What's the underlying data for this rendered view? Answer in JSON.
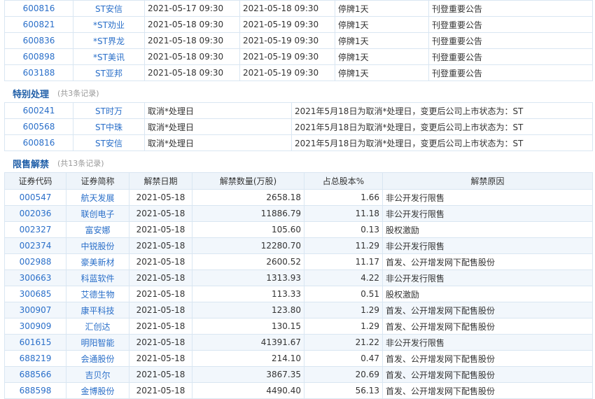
{
  "suspension": {
    "rows": [
      {
        "code": "600816",
        "name": "ST安信",
        "start": "2021-05-17 09:30",
        "end": "2021-05-18 09:30",
        "duration": "停牌1天",
        "reason": "刊登重要公告"
      },
      {
        "code": "600821",
        "name": "*ST劝业",
        "start": "2021-05-18 09:30",
        "end": "2021-05-19 09:30",
        "duration": "停牌1天",
        "reason": "刊登重要公告"
      },
      {
        "code": "600836",
        "name": "*ST界龙",
        "start": "2021-05-18 09:30",
        "end": "2021-05-19 09:30",
        "duration": "停牌1天",
        "reason": "刊登重要公告"
      },
      {
        "code": "600898",
        "name": "*ST美讯",
        "start": "2021-05-18 09:30",
        "end": "2021-05-19 09:30",
        "duration": "停牌1天",
        "reason": "刊登重要公告"
      },
      {
        "code": "603188",
        "name": "ST亚邦",
        "start": "2021-05-18 09:30",
        "end": "2021-05-19 09:30",
        "duration": "停牌1天",
        "reason": "刊登重要公告"
      }
    ]
  },
  "special": {
    "title": "特别处理",
    "count": "(共3条记录)",
    "rows": [
      {
        "code": "600241",
        "name": "ST时万",
        "type": "取消*处理日",
        "desc": "2021年5月18日为取消*处理日，变更后公司上市状态为：ST"
      },
      {
        "code": "600568",
        "name": "ST中珠",
        "type": "取消*处理日",
        "desc": "2021年5月18日为取消*处理日，变更后公司上市状态为：ST"
      },
      {
        "code": "600816",
        "name": "ST安信",
        "type": "取消*处理日",
        "desc": "2021年5月18日为取消*处理日，变更后公司上市状态为：ST"
      }
    ]
  },
  "unlock": {
    "title": "限售解禁",
    "count": "(共13条记录)",
    "headers": {
      "code": "证券代码",
      "name": "证券简称",
      "date": "解禁日期",
      "qty": "解禁数量(万股)",
      "pct": "占总股本%",
      "reason": "解禁原因"
    },
    "rows": [
      {
        "code": "000547",
        "name": "航天发展",
        "date": "2021-05-18",
        "qty": "2658.18",
        "pct": "1.66",
        "reason": "非公开发行限售"
      },
      {
        "code": "002036",
        "name": "联创电子",
        "date": "2021-05-18",
        "qty": "11886.79",
        "pct": "11.18",
        "reason": "非公开发行限售"
      },
      {
        "code": "002327",
        "name": "富安娜",
        "date": "2021-05-18",
        "qty": "105.60",
        "pct": "0.13",
        "reason": "股权激励"
      },
      {
        "code": "002374",
        "name": "中锐股份",
        "date": "2021-05-18",
        "qty": "12280.70",
        "pct": "11.29",
        "reason": "非公开发行限售"
      },
      {
        "code": "002988",
        "name": "豪美新材",
        "date": "2021-05-18",
        "qty": "2600.52",
        "pct": "11.17",
        "reason": "首发、公开增发网下配售股份"
      },
      {
        "code": "300663",
        "name": "科蓝软件",
        "date": "2021-05-18",
        "qty": "1313.93",
        "pct": "4.22",
        "reason": "非公开发行限售"
      },
      {
        "code": "300685",
        "name": "艾德生物",
        "date": "2021-05-18",
        "qty": "113.33",
        "pct": "0.51",
        "reason": "股权激励"
      },
      {
        "code": "300907",
        "name": "康平科技",
        "date": "2021-05-18",
        "qty": "123.80",
        "pct": "1.29",
        "reason": "首发、公开增发网下配售股份"
      },
      {
        "code": "300909",
        "name": "汇创达",
        "date": "2021-05-18",
        "qty": "130.15",
        "pct": "1.29",
        "reason": "首发、公开增发网下配售股份"
      },
      {
        "code": "601615",
        "name": "明阳智能",
        "date": "2021-05-18",
        "qty": "41391.67",
        "pct": "21.22",
        "reason": "非公开发行限售"
      },
      {
        "code": "688219",
        "name": "会通股份",
        "date": "2021-05-18",
        "qty": "214.10",
        "pct": "0.47",
        "reason": "首发、公开增发网下配售股份"
      },
      {
        "code": "688566",
        "name": "吉贝尔",
        "date": "2021-05-18",
        "qty": "3867.35",
        "pct": "20.69",
        "reason": "首发、公开增发网下配售股份"
      },
      {
        "code": "688598",
        "name": "金博股份",
        "date": "2021-05-18",
        "qty": "4490.40",
        "pct": "56.13",
        "reason": "首发、公开增发网下配售股份"
      }
    ]
  }
}
